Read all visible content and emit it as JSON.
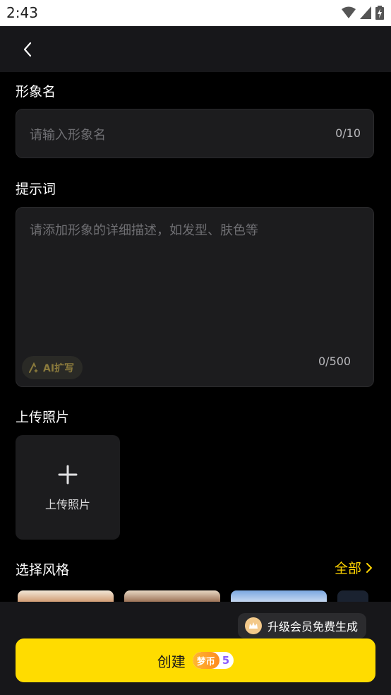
{
  "status": {
    "time": "2:43"
  },
  "name_section": {
    "label": "形象名",
    "placeholder": "请输入形象名",
    "counter": "0/10"
  },
  "prompt_section": {
    "label": "提示词",
    "placeholder": "请添加形象的详细描述，如发型、肤色等",
    "counter": "0/500",
    "ai_button": "AI扩写"
  },
  "upload_section": {
    "label": "上传照片",
    "tile_label": "上传照片"
  },
  "style_section": {
    "label": "选择风格",
    "all_link": "全部"
  },
  "footer": {
    "vip_text": "升级会员免费生成",
    "create_label": "创建",
    "coin_label": "梦币",
    "coin_cost": "5"
  },
  "colors": {
    "accent": "#ffd400",
    "button": "#ffdc00",
    "background": "#000000"
  }
}
